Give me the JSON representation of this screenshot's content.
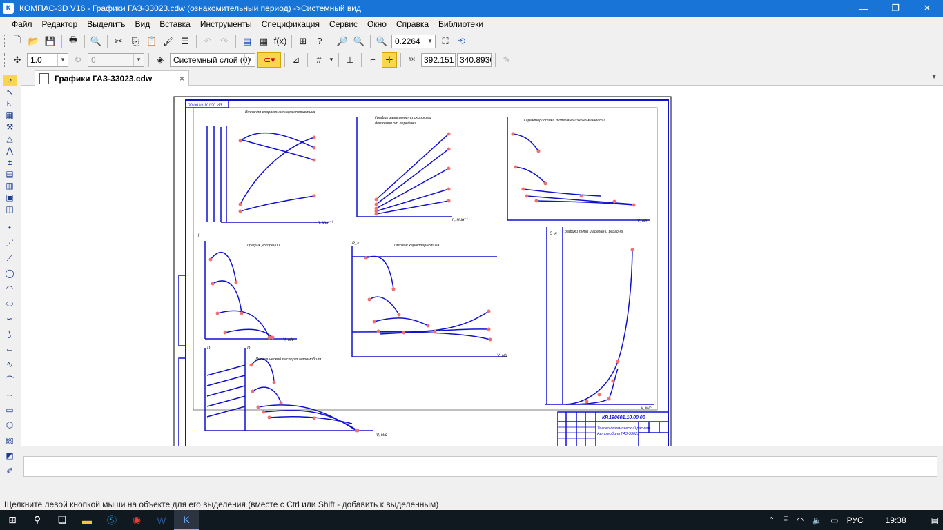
{
  "window": {
    "title": "КОМПАС-3D V16  - Графики ГАЗ-33023.cdw (ознакомительный период) ->Системный вид",
    "app_icon": "К",
    "minimize": "—",
    "maximize": "❐",
    "close": "✕"
  },
  "menu": [
    "Файл",
    "Редактор",
    "Выделить",
    "Вид",
    "Вставка",
    "Инструменты",
    "Спецификация",
    "Сервис",
    "Окно",
    "Справка",
    "Библиотеки"
  ],
  "toolbar1": {
    "zoom_value": "0.2264"
  },
  "toolbar2": {
    "step_value": "1.0",
    "angle_value": "0",
    "layer_value": "Системный слой (0)",
    "coord_x": "392.151",
    "coord_y": "340.8930"
  },
  "document_tab": {
    "label": "Графики ГАЗ-33023.cdw",
    "close": "×"
  },
  "status": "Щелкните левой кнопкой мыши на объекте для его выделения (вместе с Ctrl или Shift - добавить к выделенным)",
  "taskbar": {
    "lang": "РУС",
    "time": "19:38"
  },
  "drawing": {
    "stamp_code": "КР.190601.10.00.00",
    "stamp_left_text": "00.0010.10100.ИЗ",
    "stamp_desc1": "Тягово-динамический расчет",
    "stamp_desc2": "Автомобиля ГАЗ-33023",
    "chart_titles": {
      "c1": "Внешняя скоростная характеристика",
      "c2": "График зависимости скорости",
      "c2b": "движения от передачи",
      "c3": "Характеристика топливной экономичности",
      "c4": "График ускорений",
      "c5": "Тяговая характеристика",
      "c6": "Графики пути и времени разгона",
      "c7": "Динамический паспорт автомобиля"
    },
    "axis_labels": {
      "v": "V, м/с",
      "n": "n, мин⁻¹",
      "s": "S_н",
      "j": "j",
      "d": "D",
      "p": "P_к"
    }
  }
}
